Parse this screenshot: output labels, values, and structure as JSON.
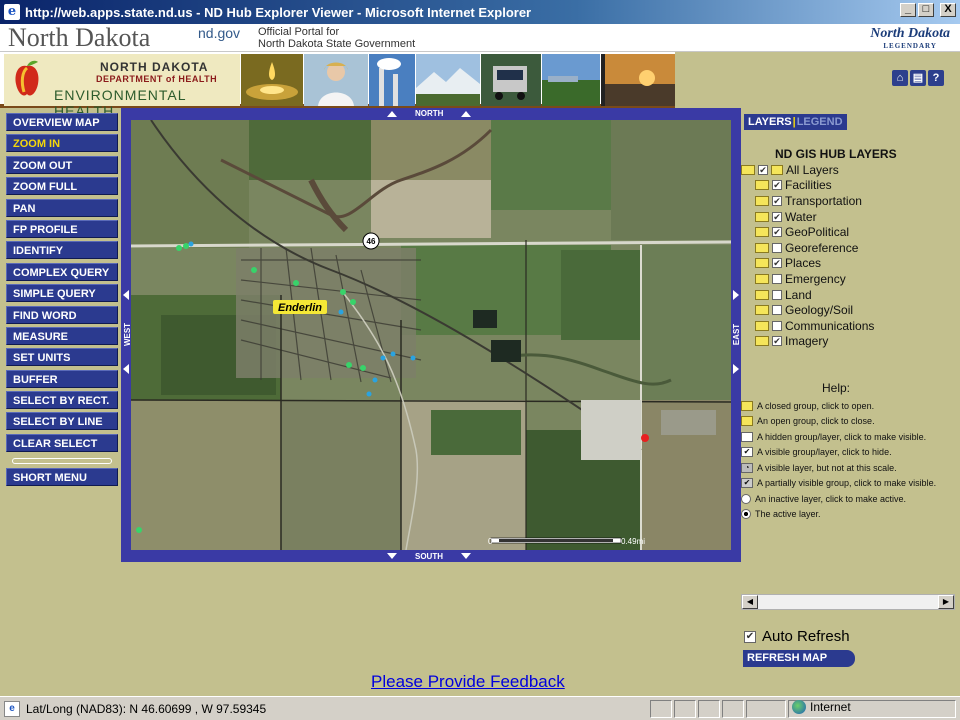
{
  "window": {
    "title": "http://web.apps.state.nd.us - ND Hub Explorer Viewer - Microsoft Internet Explorer",
    "ie_icon": "e",
    "minimize": "_",
    "restore": "□",
    "close": "X"
  },
  "header": {
    "title": "North Dakota",
    "gov": "nd.gov",
    "portal_line1": "Official Portal for",
    "portal_line2": "North Dakota State Government",
    "logo": "North Dakota",
    "logo_sub": "LEGENDARY"
  },
  "dept": {
    "line1": "NORTH DAKOTA",
    "line2": "DEPARTMENT of HEALTH",
    "line3": "ENVIRONMENTAL HEALTH"
  },
  "util_icons": [
    "home-icon",
    "print-icon",
    "help-icon"
  ],
  "util_labels": [
    "⌂",
    "▤",
    "?"
  ],
  "menu": {
    "items": [
      "OVERVIEW MAP",
      "ZOOM IN",
      "ZOOM OUT",
      "ZOOM FULL",
      "PAN",
      "FP PROFILE",
      "IDENTIFY",
      "COMPLEX QUERY",
      "SIMPLE QUERY",
      "FIND WORD",
      "MEASURE",
      "SET UNITS",
      "BUFFER",
      "SELECT BY RECT.",
      "SELECT BY LINE",
      "CLEAR SELECT"
    ],
    "active": "ZOOM IN",
    "short_menu": "SHORT MENU"
  },
  "map": {
    "north": "NORTH",
    "south": "SOUTH",
    "east": "EAST",
    "west": "WEST",
    "town_label": "Enderlin",
    "route_label": "46",
    "scale_label": "0",
    "scale_end": "0.49mi",
    "colors": {
      "frame": "#3a3aa5",
      "green_dot": "#38d36a",
      "blue_dot": "#2aa3e0",
      "red_dot": "#e82020"
    }
  },
  "panel": {
    "tab_layers": "LAYERS",
    "tab_sep": "|",
    "tab_legend": "LEGEND",
    "layers_title": "ND GIS HUB LAYERS",
    "layers": [
      {
        "name": "All Layers",
        "checked": true,
        "indent": 0
      },
      {
        "name": "Facilities",
        "checked": true,
        "indent": 1
      },
      {
        "name": "Transportation",
        "checked": true,
        "indent": 1
      },
      {
        "name": "Water",
        "checked": true,
        "indent": 1
      },
      {
        "name": "GeoPolitical",
        "checked": true,
        "indent": 1
      },
      {
        "name": "Georeference",
        "checked": false,
        "indent": 1
      },
      {
        "name": "Places",
        "checked": true,
        "indent": 1
      },
      {
        "name": "Emergency",
        "checked": false,
        "indent": 1
      },
      {
        "name": "Land",
        "checked": false,
        "indent": 1
      },
      {
        "name": "Geology/Soil",
        "checked": false,
        "indent": 1
      },
      {
        "name": "Communications",
        "checked": false,
        "indent": 1
      },
      {
        "name": "Imagery",
        "checked": true,
        "indent": 1
      }
    ],
    "help_title": "Help:",
    "help": [
      {
        "icon": "folder-closed",
        "text": "A closed group, click to open."
      },
      {
        "icon": "folder-open",
        "text": "An open group, click to close."
      },
      {
        "icon": "checkbox-empty",
        "text": "A hidden group/layer, click to make visible."
      },
      {
        "icon": "checkbox-checked",
        "text": "A visible group/layer, click to hide."
      },
      {
        "icon": "checkbox-scale",
        "text": "A visible layer, but not at this scale."
      },
      {
        "icon": "checkbox-partial",
        "text": "A partially visible group, click to make visible."
      },
      {
        "icon": "radio-off",
        "text": "An inactive layer, click to make active."
      },
      {
        "icon": "radio-on",
        "text": "The active layer."
      }
    ],
    "auto_refresh": "Auto Refresh",
    "auto_refresh_checked": true,
    "refresh_button": "REFRESH MAP"
  },
  "feedback": "Please Provide Feedback",
  "status": {
    "text": "Lat/Long (NAD83):  N 46.60699 ,  W 97.59345",
    "zone": "Internet"
  }
}
